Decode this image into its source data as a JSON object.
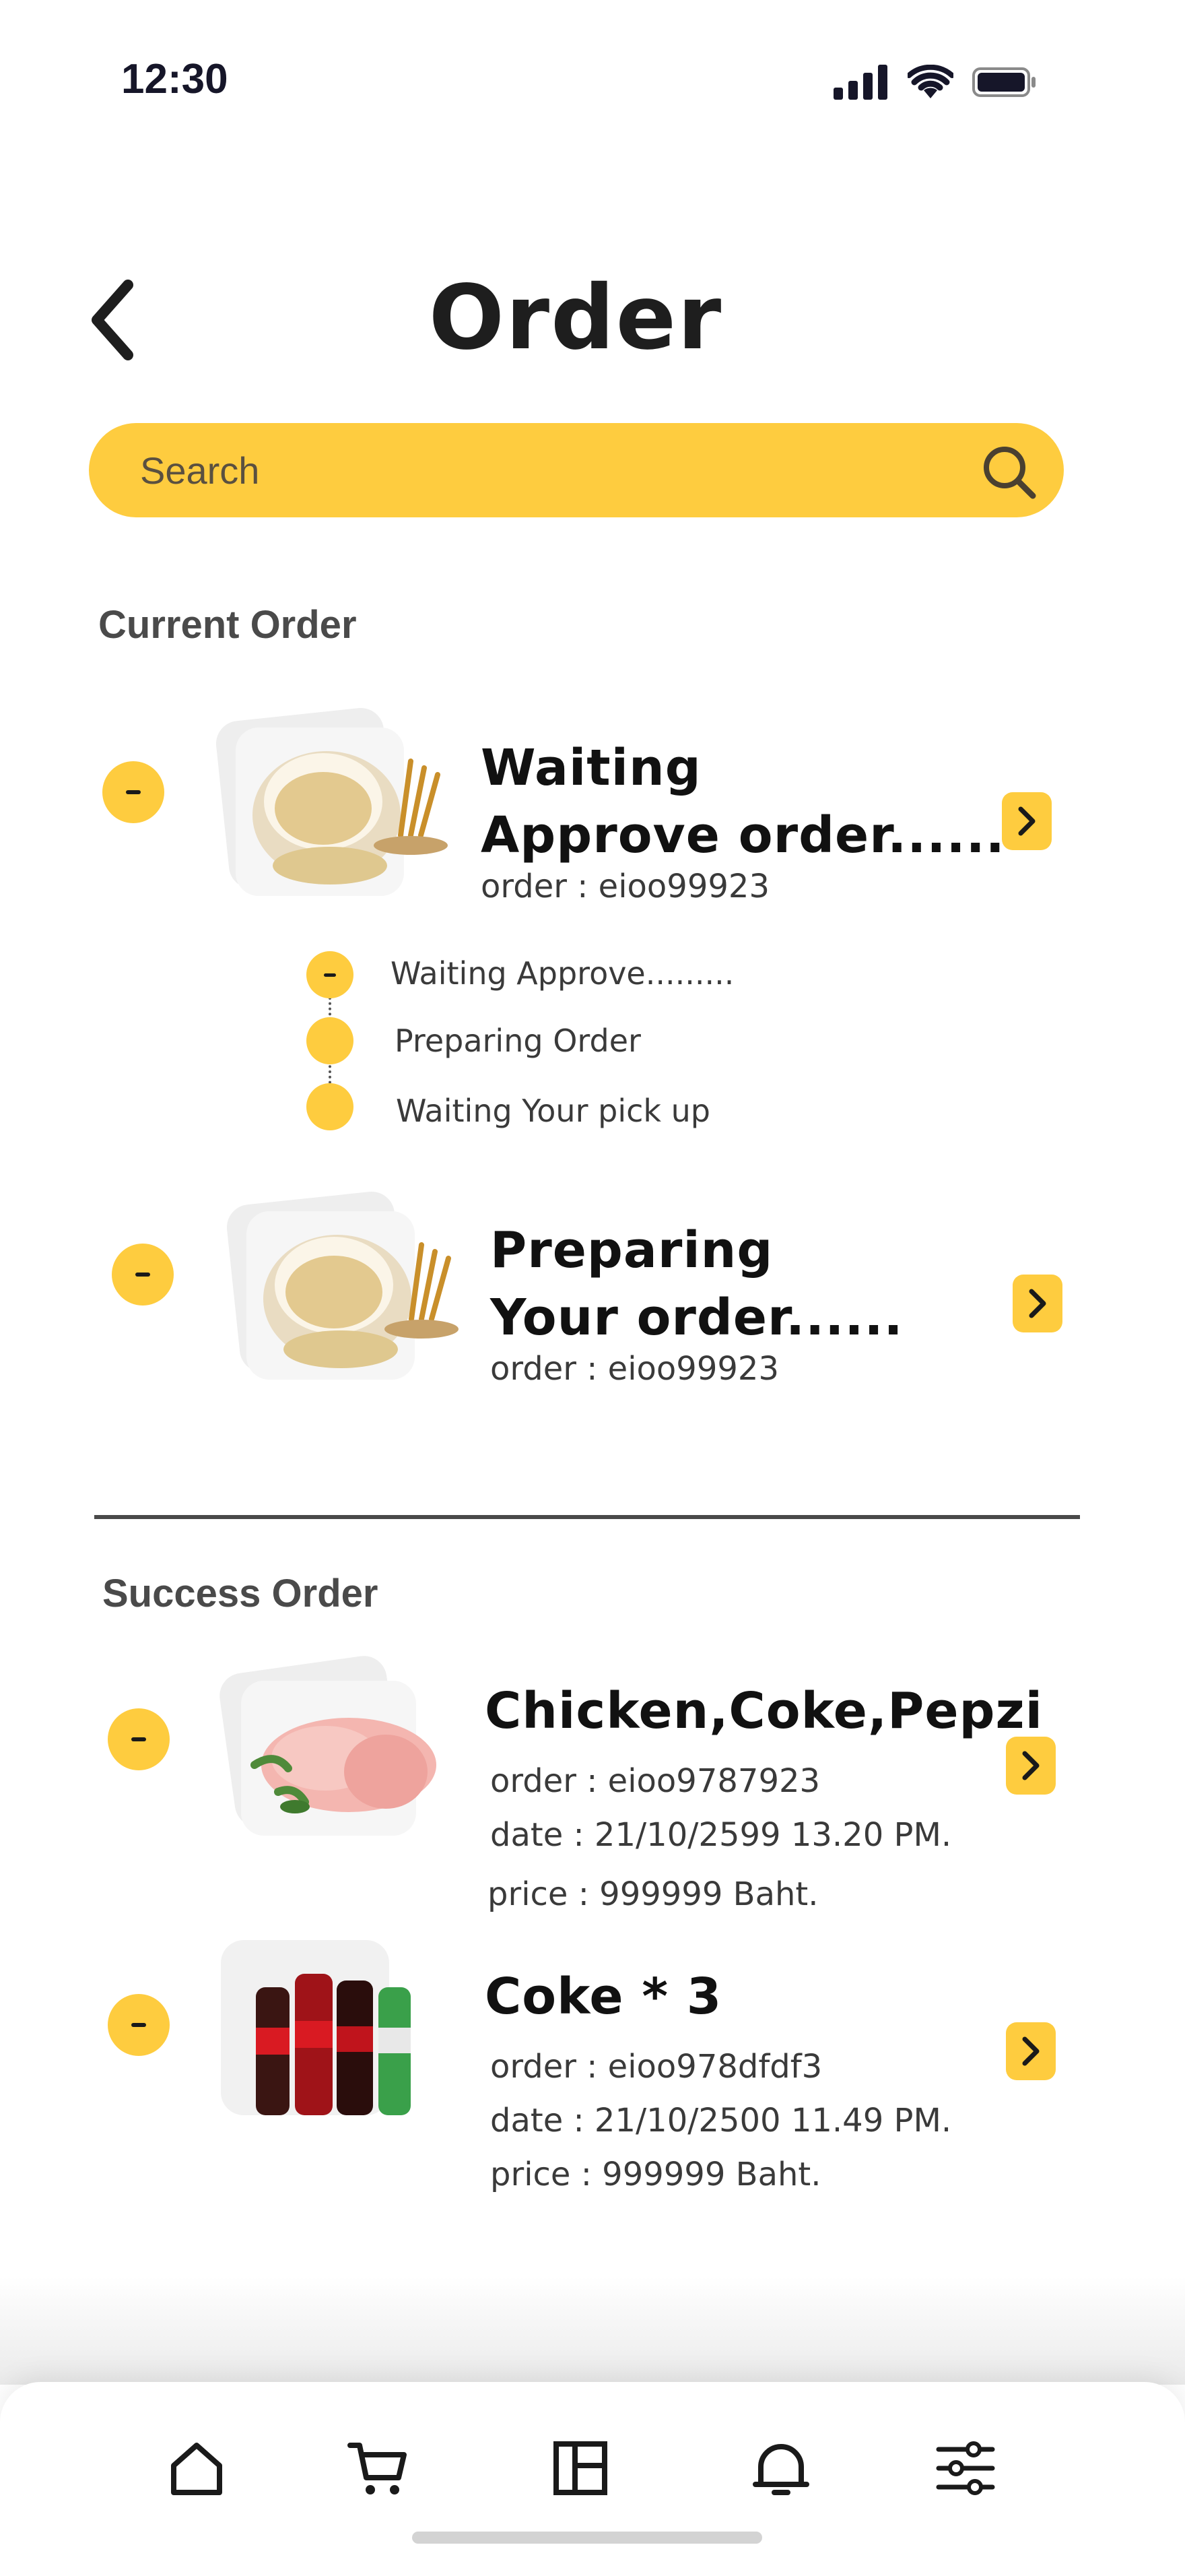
{
  "status_bar": {
    "time": "12:30"
  },
  "header": {
    "title": "Order"
  },
  "search": {
    "placeholder": "Search"
  },
  "current_section": {
    "title": "Current Order"
  },
  "current_orders": [
    {
      "title_line1": "Waiting",
      "title_line2": "Approve order......",
      "order": "order : eioo99923"
    },
    {
      "title_line1": "Preparing",
      "title_line2": "Your order......",
      "order": "order : eioo99923"
    }
  ],
  "timeline": [
    "Waiting Approve.........",
    "Preparing Order",
    "Waiting Your pick up"
  ],
  "success_section": {
    "title": "Success Order"
  },
  "success_orders": [
    {
      "title": "Chicken,Coke,Pepzi",
      "order": "order : eioo9787923",
      "date": "date   : 21/10/2599 13.20 PM.",
      "price": "price   : 999999 Baht."
    },
    {
      "title": "Coke * 3",
      "order": "order : eioo978dfdf3",
      "date": "date   : 21/10/2500 11.49 PM.",
      "price": "price   : 999999 Baht."
    }
  ],
  "colors": {
    "accent": "#FECC3F",
    "text": "#111111",
    "section": "#4a4a4a"
  },
  "icons": [
    "home-icon",
    "cart-icon",
    "layout-icon",
    "bell-icon",
    "sliders-icon"
  ]
}
